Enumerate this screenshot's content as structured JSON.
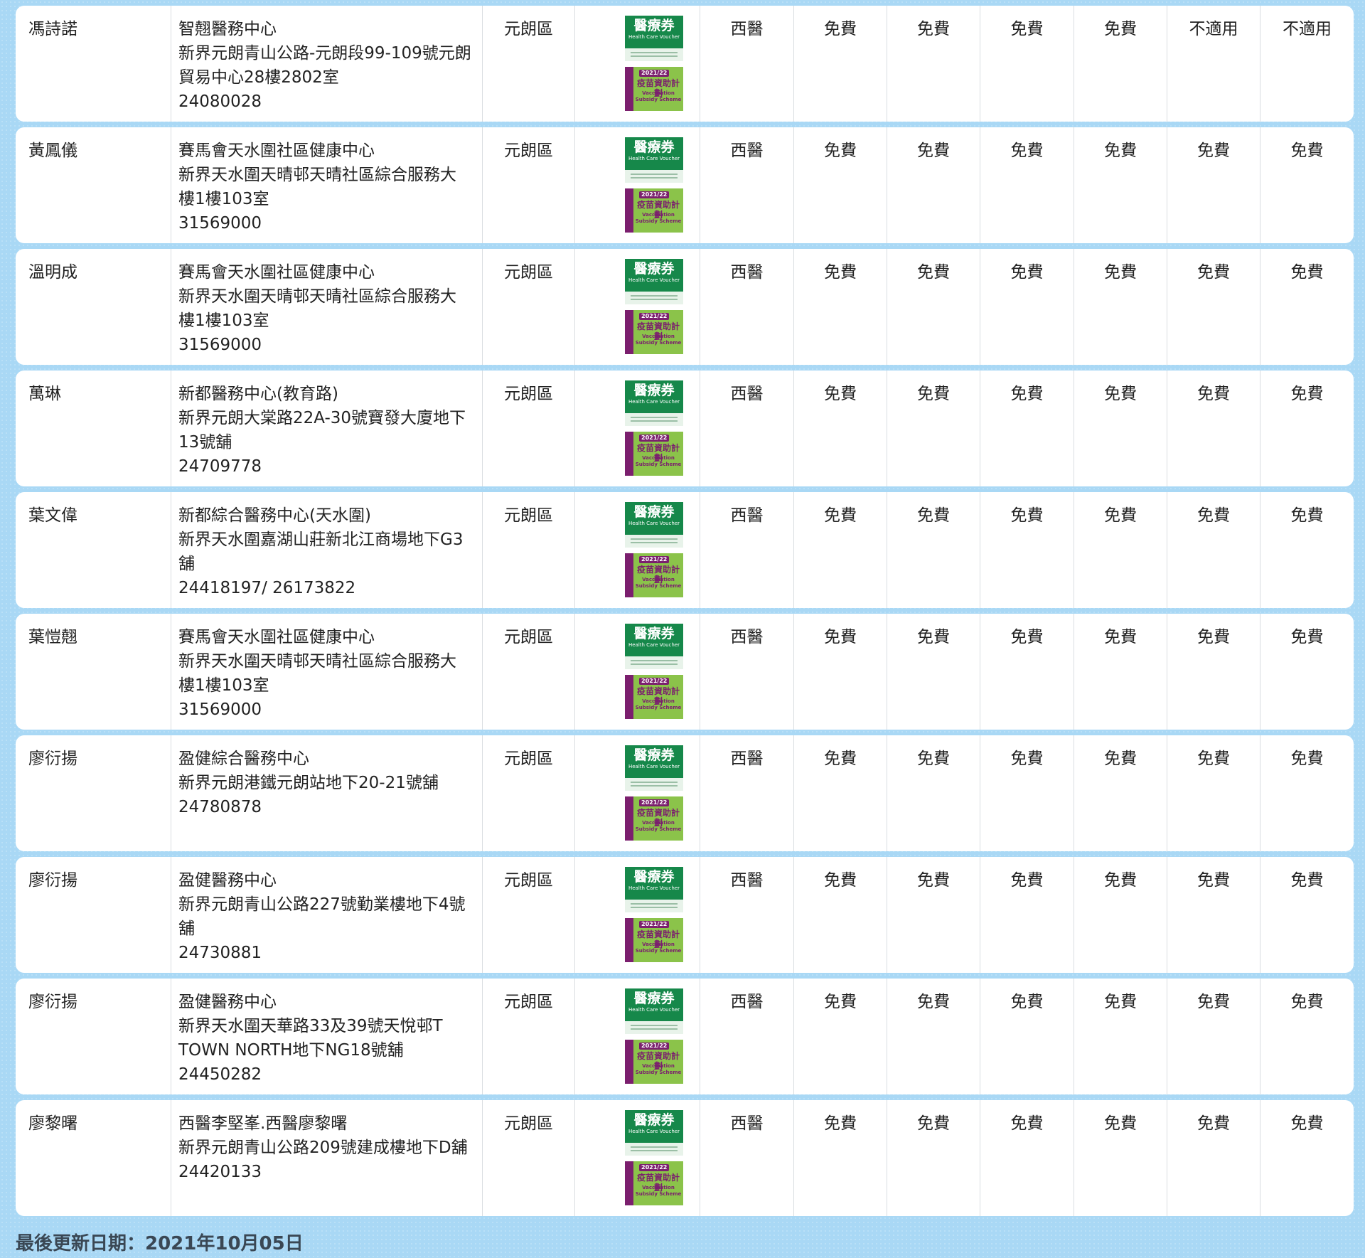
{
  "badges": {
    "hcv_title": "醫療券",
    "hcv_sub": "Health Care Voucher",
    "vss_year": "2021/22",
    "vss_title": "疫苗資助計劃",
    "vss_en_1": "Vaccination",
    "vss_en_2": "Subsidy Scheme"
  },
  "rows": [
    {
      "name": "馮詩諾",
      "clinic_lines": [
        "智翹醫務中心",
        "新界元朗青山公路-元朗段99-109號元朗",
        "貿易中心28樓2802室",
        "24080028"
      ],
      "district": "元朗區",
      "specialty": "西醫",
      "fees": [
        "免費",
        "免費",
        "免費",
        "免費",
        "不適用",
        "不適用"
      ]
    },
    {
      "name": "黃鳳儀",
      "clinic_lines": [
        "賽馬會天水圍社區健康中心",
        "新界天水圍天晴邨天晴社區綜合服務大",
        "樓1樓103室",
        "31569000"
      ],
      "district": "元朗區",
      "specialty": "西醫",
      "fees": [
        "免費",
        "免費",
        "免費",
        "免費",
        "免費",
        "免費"
      ]
    },
    {
      "name": "溫明成",
      "clinic_lines": [
        "賽馬會天水圍社區健康中心",
        "新界天水圍天晴邨天晴社區綜合服務大",
        "樓1樓103室",
        "31569000"
      ],
      "district": "元朗區",
      "specialty": "西醫",
      "fees": [
        "免費",
        "免費",
        "免費",
        "免費",
        "免費",
        "免費"
      ]
    },
    {
      "name": "萬琳",
      "clinic_lines": [
        "新都醫務中心(教育路)",
        "新界元朗大棠路22A-30號寶發大廈地下",
        "13號舖",
        "24709778"
      ],
      "district": "元朗區",
      "specialty": "西醫",
      "fees": [
        "免費",
        "免費",
        "免費",
        "免費",
        "免費",
        "免費"
      ]
    },
    {
      "name": "葉文偉",
      "clinic_lines": [
        "新都綜合醫務中心(天水圍)",
        "新界天水圍嘉湖山莊新北江商場地下G3",
        "舖",
        "24418197/ 26173822"
      ],
      "district": "元朗區",
      "specialty": "西醫",
      "fees": [
        "免費",
        "免費",
        "免費",
        "免費",
        "免費",
        "免費"
      ]
    },
    {
      "name": "葉愷翹",
      "clinic_lines": [
        "賽馬會天水圍社區健康中心",
        "新界天水圍天晴邨天晴社區綜合服務大",
        "樓1樓103室",
        "31569000"
      ],
      "district": "元朗區",
      "specialty": "西醫",
      "fees": [
        "免費",
        "免費",
        "免費",
        "免費",
        "免費",
        "免費"
      ]
    },
    {
      "name": "廖衍揚",
      "clinic_lines": [
        "盈健綜合醫務中心",
        "新界元朗港鐵元朗站地下20-21號舖",
        "24780878"
      ],
      "district": "元朗區",
      "specialty": "西醫",
      "fees": [
        "免費",
        "免費",
        "免費",
        "免費",
        "免費",
        "免費"
      ]
    },
    {
      "name": "廖衍揚",
      "clinic_lines": [
        "盈健醫務中心",
        "新界元朗青山公路227號勤業樓地下4號",
        "舖",
        "24730881"
      ],
      "district": "元朗區",
      "specialty": "西醫",
      "fees": [
        "免費",
        "免費",
        "免費",
        "免費",
        "免費",
        "免費"
      ]
    },
    {
      "name": "廖衍揚",
      "clinic_lines": [
        "盈健醫務中心",
        "新界天水圍天華路33及39號天悅邨T",
        "TOWN NORTH地下NG18號舖",
        "24450282"
      ],
      "district": "元朗區",
      "specialty": "西醫",
      "fees": [
        "免費",
        "免費",
        "免費",
        "免費",
        "免費",
        "免費"
      ]
    },
    {
      "name": "廖黎曙",
      "clinic_lines": [
        "西醫李堅峯.西醫廖黎曙",
        "新界元朗青山公路209號建成樓地下D舖",
        "24420133"
      ],
      "district": "元朗區",
      "specialty": "西醫",
      "fees": [
        "免費",
        "免費",
        "免費",
        "免費",
        "免費",
        "免費"
      ]
    }
  ],
  "footer": {
    "last_updated": "最後更新日期：2021年10月05日"
  }
}
